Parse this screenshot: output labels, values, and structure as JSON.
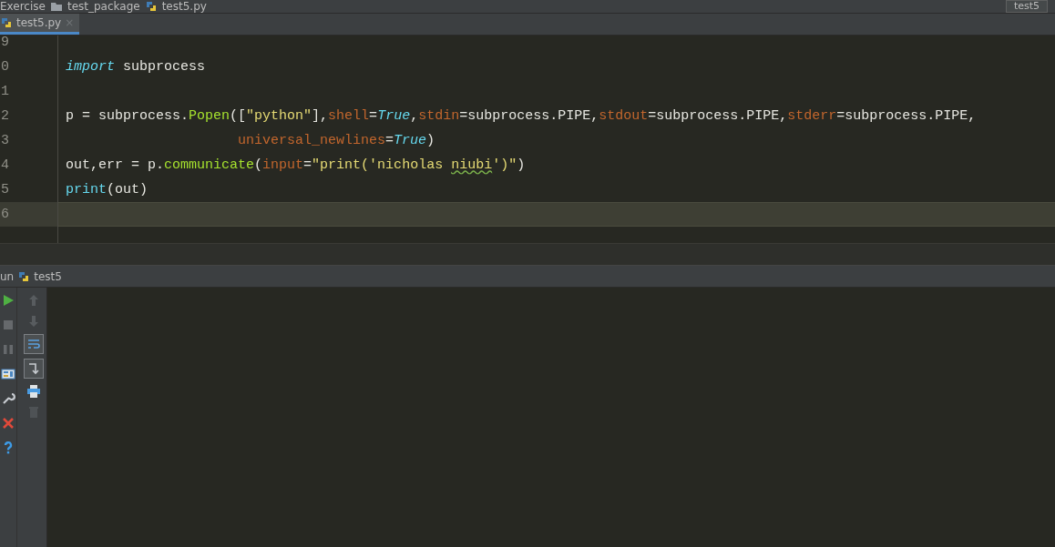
{
  "breadcrumbs": [
    {
      "label": "Exercise"
    },
    {
      "label": "test_package"
    },
    {
      "label": "test5.py"
    }
  ],
  "run_config": {
    "label": "test5"
  },
  "tabs": [
    {
      "label": "test5.py",
      "close": "×",
      "selected": true
    }
  ],
  "editor": {
    "lines": [
      {
        "number": "9",
        "current": false
      },
      {
        "number": "0",
        "current": false,
        "tokens": [
          {
            "kind": "keyword",
            "text": "import"
          },
          {
            "kind": "plain",
            "text": " subprocess"
          }
        ]
      },
      {
        "number": "1",
        "current": false
      },
      {
        "number": "2",
        "current": false,
        "tokens": [
          {
            "kind": "plain",
            "text": "p = subprocess."
          },
          {
            "kind": "func",
            "text": "Popen"
          },
          {
            "kind": "plain",
            "text": "(["
          },
          {
            "kind": "string",
            "text": "\"python\""
          },
          {
            "kind": "plain",
            "text": "],"
          },
          {
            "kind": "param",
            "text": "shell"
          },
          {
            "kind": "plain",
            "text": "="
          },
          {
            "kind": "keyword",
            "text": "True"
          },
          {
            "kind": "plain",
            "text": ","
          },
          {
            "kind": "param",
            "text": "stdin"
          },
          {
            "kind": "plain",
            "text": "=subprocess.PIPE,"
          },
          {
            "kind": "param",
            "text": "stdout"
          },
          {
            "kind": "plain",
            "text": "=subprocess.PIPE,"
          },
          {
            "kind": "param",
            "text": "stderr"
          },
          {
            "kind": "plain",
            "text": "=subprocess.PIPE,"
          }
        ]
      },
      {
        "number": "3",
        "current": false,
        "continuation": true,
        "tokens": [
          {
            "kind": "param",
            "text": "universal_newlines"
          },
          {
            "kind": "plain",
            "text": "="
          },
          {
            "kind": "keyword",
            "text": "True"
          },
          {
            "kind": "plain",
            "text": ")"
          }
        ]
      },
      {
        "number": "4",
        "current": false,
        "tokens": [
          {
            "kind": "plain",
            "text": "out,err = p."
          },
          {
            "kind": "func",
            "text": "communicate"
          },
          {
            "kind": "plain",
            "text": "("
          },
          {
            "kind": "param",
            "text": "input"
          },
          {
            "kind": "plain",
            "text": "="
          },
          {
            "kind": "string",
            "text": "\"print('nicholas "
          },
          {
            "kind": "typo",
            "text": "niubi"
          },
          {
            "kind": "string",
            "text": "')\""
          },
          {
            "kind": "plain",
            "text": ")"
          }
        ]
      },
      {
        "number": "5",
        "current": false,
        "tokens": [
          {
            "kind": "builtin",
            "text": "print"
          },
          {
            "kind": "plain",
            "text": "(out)"
          }
        ]
      },
      {
        "number": "6",
        "current": true
      }
    ]
  },
  "run_panel": {
    "title": "un",
    "config": "test5",
    "left_toolbar": [
      {
        "disabled": false
      },
      {
        "disabled": true
      },
      {
        "disabled": true
      },
      {
        "disabled": false
      },
      {
        "disabled": false
      },
      {
        "disabled": false
      },
      {
        "disabled": false
      }
    ],
    "right_toolbar": [
      {
        "disabled": true,
        "on": false
      },
      {
        "disabled": true,
        "on": false
      },
      {
        "disabled": false,
        "on": true
      },
      {
        "disabled": false,
        "on": true
      },
      {
        "disabled": false,
        "on": false
      },
      {
        "disabled": true,
        "on": false
      }
    ]
  }
}
